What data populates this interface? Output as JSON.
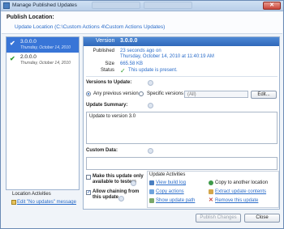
{
  "window": {
    "title": "Manage Published Updates",
    "close_glyph": "✕"
  },
  "header": {
    "title": "Publish Location:",
    "path": "Update Location (C:\\Custom Actions 4\\Custom Actions Updates)"
  },
  "versions": [
    {
      "number": "3.0.0.0",
      "date": "Thursday, October 14, 2010",
      "selected": true
    },
    {
      "number": "2.0.0.0",
      "date": "Thursday, October 14, 2010",
      "selected": false
    }
  ],
  "location_activities": {
    "title": "Location Activities",
    "edit_link": "Edit \"No updates\" message"
  },
  "detail": {
    "version_label": "Version",
    "version_value": "3.0.0.0",
    "published_label": "Published",
    "published_rel": "23 seconds ago on",
    "published_abs": "Thursday, October 14, 2010 at 11:40:19 AM",
    "size_label": "Size",
    "size_value": "665.58 KB",
    "status_label": "Status",
    "status_value": "This update is present.",
    "status_check": "✓"
  },
  "versions_to_update": {
    "title": "Versions to Update:",
    "any_label": "Any previous version",
    "specific_label": "Specific versions",
    "specific_placeholder": "(All)",
    "edit_button": "Edit..."
  },
  "update_summary": {
    "title": "Update Summary:",
    "text": "Update to version 3.0"
  },
  "custom_data": {
    "title": "Custom Data:"
  },
  "options": {
    "testers_label": "Make this update only available to testers",
    "chaining_label": "Allow chaining from this update",
    "testers_checked": false,
    "chaining_checked": true
  },
  "update_activities": {
    "title": "Update Activities",
    "view_build_log": "View build log",
    "copy_actions": "Copy actions",
    "show_update_path": "Show update path",
    "copy_to_location": "Copy to another location",
    "extract_contents": "Extract update contents",
    "remove_update": "Remove this update"
  },
  "footer": {
    "publish_button": "Publish Changes",
    "close_button": "Close"
  },
  "colors": {
    "accent": "#3875d7",
    "link": "#2a6cc9",
    "ok": "#2f9b2f",
    "danger": "#c9453a"
  }
}
